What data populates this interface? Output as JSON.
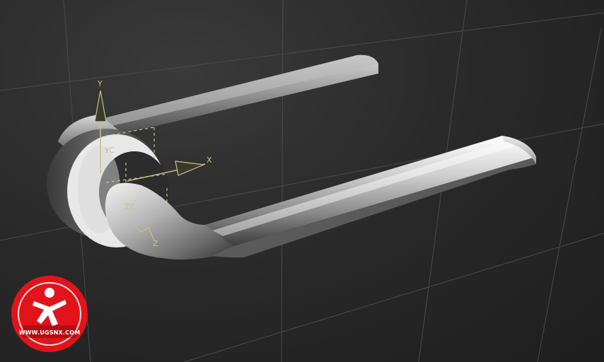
{
  "viewport": {
    "background": "#262626",
    "grid_color": "#4a4a4a"
  },
  "triad": {
    "color": "#c9c08a",
    "labels": {
      "y": "Y",
      "x": "X",
      "yc": "YC",
      "zc": "ZC",
      "z": "Z"
    }
  },
  "model": {
    "part": "door-lever-handle",
    "rosette_color": "#e8e8e8",
    "metal_light": "#f2f2f2",
    "metal_dark": "#5a5a5a"
  },
  "watermark": {
    "logo": "ugsnx-logo",
    "brand_color": "#e1141b",
    "text": "WWW.UGSNX.COM"
  }
}
